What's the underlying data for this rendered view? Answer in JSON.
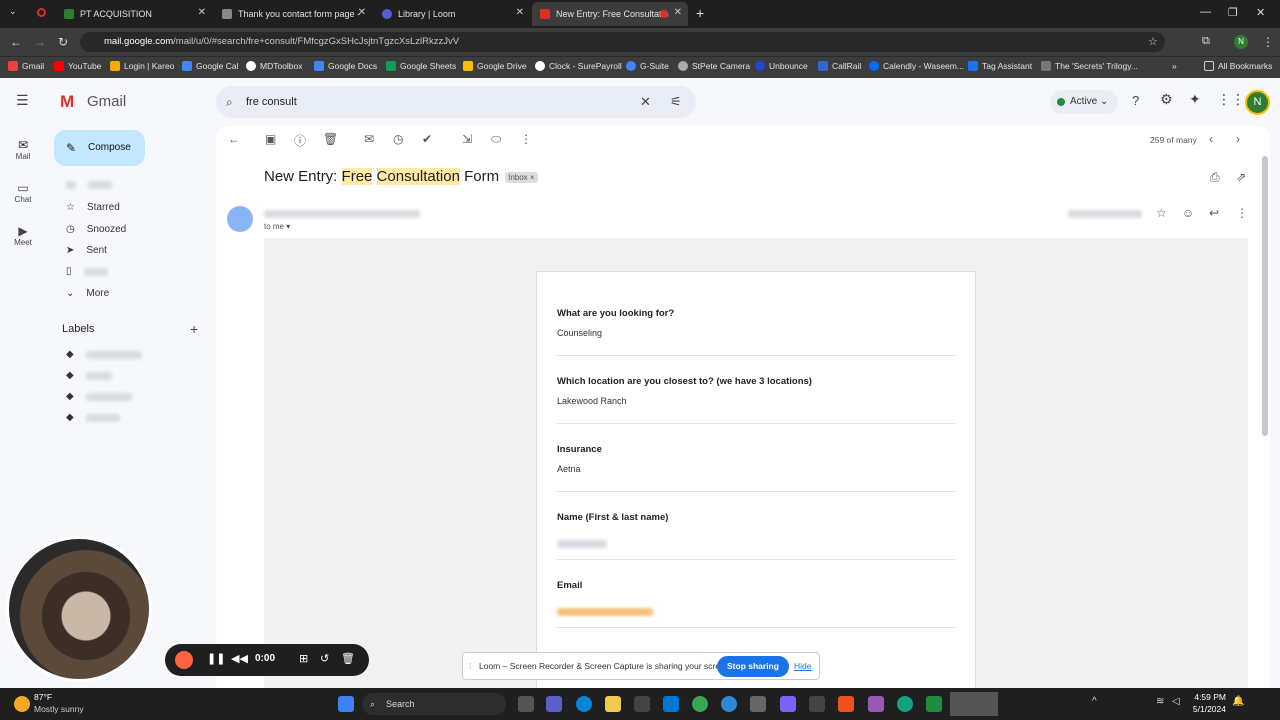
{
  "tabs": [
    {
      "label": "PT ACQUISITION",
      "color": "#2e7d32"
    },
    {
      "label": "Thank you contact form page -",
      "color": "#666"
    },
    {
      "label": "Library | Loom",
      "color": "#5b5bd6"
    },
    {
      "label": "New Entry: Free Consultatio",
      "color": "#d93025"
    }
  ],
  "url_host": "mail.google.com",
  "url_path": "/mail/u/0/#search/fre+consult/FMfcgzGxSHcJsjtnTgzcXsLzlRkzzJvV",
  "bookmarks": [
    "Gmail",
    "YouTube",
    "Login | Kareo",
    "Google Cal",
    "MDToolbox",
    "Google Docs",
    "Google Sheets",
    "Google Drive",
    "Clock - SurePayroll",
    "G-Suite",
    "StPete Camera",
    "Unbounce",
    "CallRail",
    "Calendly - Waseem...",
    "Tag Assistant",
    "The 'Secrets' Trilogy..."
  ],
  "all_bookmarks": "All Bookmarks",
  "gmail_logo": "Gmail",
  "search_value": "fre consult",
  "status": "Active",
  "avatar_letter": "N",
  "rail": {
    "mail": "Mail",
    "chat": "Chat",
    "meet": "Meet"
  },
  "compose": "Compose",
  "nav": {
    "starred": "Starred",
    "snoozed": "Snoozed",
    "sent": "Sent",
    "more": "More"
  },
  "labels_title": "Labels",
  "pager": "259 of many",
  "subject": {
    "pre": "New Entry: ",
    "h1": "Free",
    "sp": " ",
    "h2": "Consultation",
    "post": " Form",
    "tag": "Inbox ×"
  },
  "to_me": "to me",
  "form": [
    {
      "q": "What are you looking for?",
      "a": "Counseling"
    },
    {
      "q": "Which location are you closest to? (we have 3 locations)",
      "a": "Lakewood Ranch"
    },
    {
      "q": "Insurance",
      "a": "Aetna"
    },
    {
      "q": "Name (First & last name)",
      "a": ""
    },
    {
      "q": "Email",
      "a": ""
    }
  ],
  "loom": {
    "time": "0:00",
    "share_msg": "Loom – Screen Recorder & Screen Capture is sharing your screen.",
    "stop": "Stop sharing",
    "hide": "Hide"
  },
  "weather": {
    "temp": "87°F",
    "desc": "Mostly sunny"
  },
  "taskbar_search": "Search",
  "clock": {
    "time": "4:59 PM",
    "date": "5/1/2024"
  }
}
